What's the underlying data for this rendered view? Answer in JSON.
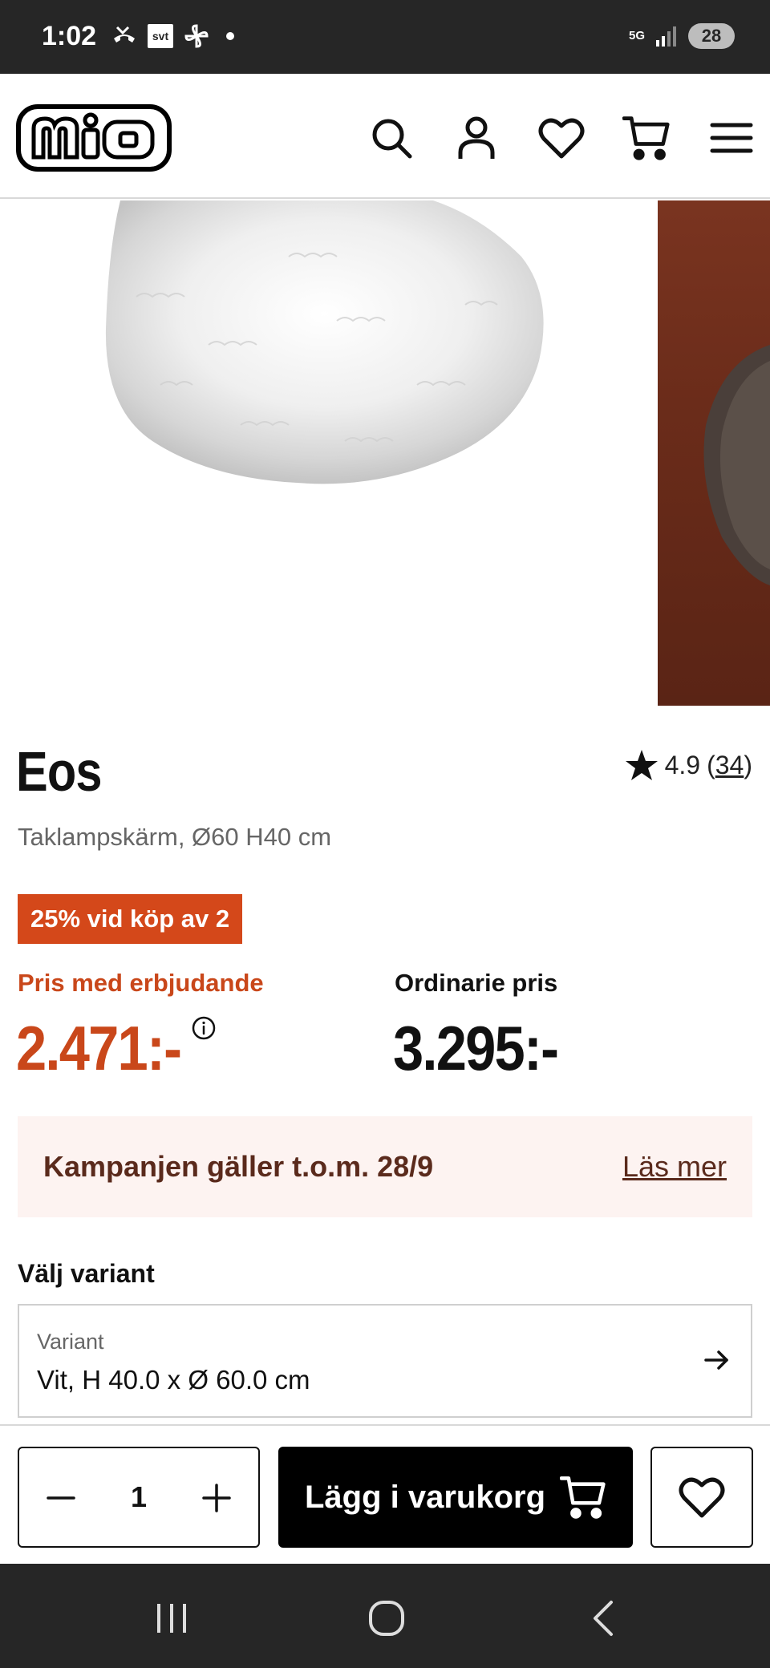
{
  "status_bar": {
    "time": "1:02",
    "left_icons": [
      "missed-call-icon",
      "svt-app-icon",
      "pinwheel-icon",
      "notification-dot-icon"
    ],
    "svt_label": "svt",
    "network_label": "5G",
    "battery": "28"
  },
  "header": {
    "logo_text": "mio",
    "icons": [
      "search-icon",
      "account-icon",
      "wishlist-icon",
      "cart-icon",
      "menu-icon"
    ]
  },
  "gallery": {
    "images": [
      "white-feather-pendant-lamp",
      "dark-feather-lamp-on-rust-background"
    ]
  },
  "product": {
    "name": "Eos",
    "rating": "4.9",
    "rating_open": "(",
    "review_count": "34",
    "rating_close": ")",
    "subtitle": "Taklampskärm, Ø60 H40 cm",
    "promo_badge": "25% vid köp av 2",
    "offer_label": "Pris med erbjudande",
    "offer_price": "2.471:-",
    "regular_label": "Ordinarie pris",
    "regular_price": "3.295:-"
  },
  "campaign": {
    "text": "Kampanjen gäller t.o.m. 28/9",
    "link": "Läs mer"
  },
  "variant": {
    "heading": "Välj variant",
    "label": "Variant",
    "value": "Vit, H 40.0 x Ø 60.0 cm"
  },
  "buy_bar": {
    "quantity": "1",
    "add_to_cart": "Lägg i varukorg"
  },
  "colors": {
    "accent": "#c9471a",
    "badge": "#d4481a",
    "campaign_bg": "#fdf3f1",
    "campaign_text": "#5a2a1c",
    "system_bar": "#262626"
  }
}
